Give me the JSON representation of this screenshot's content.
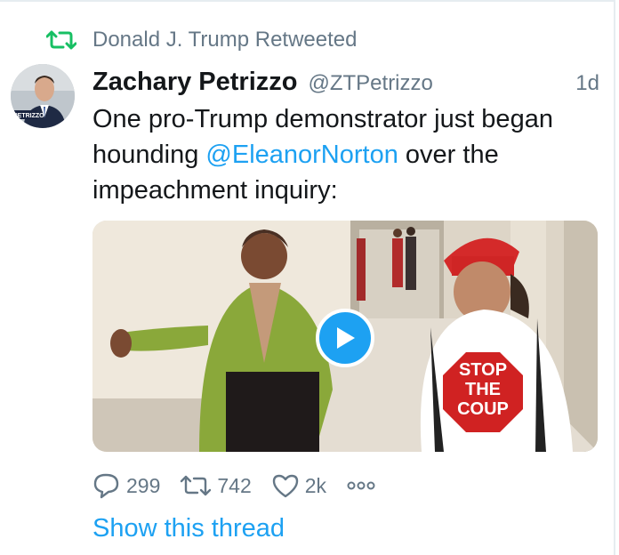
{
  "retweet_banner": {
    "icon": "retweet-icon",
    "text": "Donald J. Trump Retweeted",
    "icon_color": "#17bf63"
  },
  "tweet": {
    "author_name": "Zachary Petrizzo",
    "author_handle": "@ZTPetrizzo",
    "timestamp": "1d",
    "avatar_caption": "PETRIZZO",
    "text_parts": {
      "before": "One pro-Trump demonstrator just began hounding ",
      "mention": "@EleanorNorton",
      "after": " over the impeachment inquiry:"
    },
    "media": {
      "type": "video",
      "shirt_text_line1": "STOP",
      "shirt_text_line2": "THE",
      "shirt_text_line3": "COUP"
    }
  },
  "actions": {
    "replies": "299",
    "retweets": "742",
    "likes": "2k"
  },
  "show_thread": "Show this thread",
  "colors": {
    "accent": "#1da1f2",
    "muted": "#657786",
    "retweet_green": "#17bf63"
  }
}
